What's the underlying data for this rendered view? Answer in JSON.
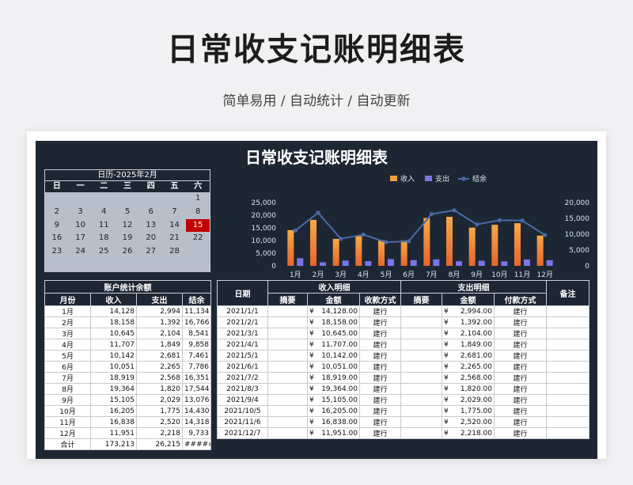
{
  "hero": {
    "title": "日常收支记账明细表",
    "subtitle": "简单易用  /  自动统计  /  自动更新"
  },
  "dashboard": {
    "title": "日常收支记账明细表"
  },
  "calendar": {
    "header": "日历-2025年2月",
    "weekdays": [
      "日",
      "一",
      "二",
      "三",
      "四",
      "五",
      "六"
    ],
    "weeks": [
      [
        "",
        "",
        "",
        "",
        "",
        "",
        "1"
      ],
      [
        "2",
        "3",
        "4",
        "5",
        "6",
        "7",
        "8"
      ],
      [
        "9",
        "10",
        "11",
        "12",
        "13",
        "14",
        "15"
      ],
      [
        "16",
        "17",
        "18",
        "19",
        "20",
        "21",
        "22"
      ],
      [
        "23",
        "24",
        "25",
        "26",
        "27",
        "28",
        ""
      ]
    ],
    "highlight": "15",
    "highlight_color": "#c00000"
  },
  "chart_data": {
    "type": "bar",
    "categories": [
      "1月",
      "2月",
      "3月",
      "4月",
      "5月",
      "6月",
      "7月",
      "8月",
      "9月",
      "10月",
      "11月",
      "12月"
    ],
    "series": [
      {
        "name": "收入",
        "type": "bar",
        "axis": "left",
        "color": "#f5a040",
        "values": [
          14128,
          18158,
          10645,
          11707,
          10142,
          10051,
          18919,
          19364,
          15105,
          16205,
          16838,
          11951
        ]
      },
      {
        "name": "支出",
        "type": "bar",
        "axis": "left",
        "color": "#7b74e8",
        "values": [
          2994,
          1392,
          2104,
          1849,
          2681,
          2265,
          2568,
          1820,
          2029,
          1775,
          2520,
          2218
        ]
      },
      {
        "name": "结余",
        "type": "line",
        "axis": "right",
        "color": "#4a6aa5",
        "values": [
          11134,
          16766,
          8541,
          9858,
          7461,
          7786,
          16351,
          17544,
          13076,
          14430,
          14318,
          9733
        ]
      }
    ],
    "y_left": {
      "min": 0,
      "max": 25000,
      "ticks": [
        "25,000",
        "20,000",
        "15,000",
        "10,000",
        "5,000",
        "0"
      ]
    },
    "y_right": {
      "min": 0,
      "max": 20000,
      "ticks": [
        "20,000",
        "15,000",
        "10,000",
        "5,000",
        "0"
      ]
    },
    "legend_position": "top-right",
    "grid": false
  },
  "account": {
    "title": "账户统计余额",
    "headers": [
      "月份",
      "收入",
      "支出",
      "结余"
    ],
    "rows": [
      [
        "1月",
        "14,128",
        "2,994",
        "11,134"
      ],
      [
        "2月",
        "18,158",
        "1,392",
        "16,766"
      ],
      [
        "3月",
        "10,645",
        "2,104",
        "8,541"
      ],
      [
        "4月",
        "11,707",
        "1,849",
        "9,858"
      ],
      [
        "5月",
        "10,142",
        "2,681",
        "7,461"
      ],
      [
        "6月",
        "10,051",
        "2,265",
        "7,786"
      ],
      [
        "7月",
        "18,919",
        "2,568",
        "16,351"
      ],
      [
        "8月",
        "19,364",
        "1,820",
        "17,544"
      ],
      [
        "9月",
        "15,105",
        "2,029",
        "13,076"
      ],
      [
        "10月",
        "16,205",
        "1,775",
        "14,430"
      ],
      [
        "11月",
        "16,838",
        "2,520",
        "14,318"
      ],
      [
        "12月",
        "11,951",
        "2,218",
        "9,733"
      ],
      [
        "合计",
        "173,213",
        "26,215",
        "######"
      ]
    ]
  },
  "detail": {
    "date_header": "日期",
    "income_header": "收入明细",
    "expense_header": "支出明细",
    "note_header": "备注",
    "sub_headers": [
      "摘要",
      "金额",
      "收款方式",
      "摘要",
      "金额",
      "付款方式"
    ],
    "currency": "¥",
    "rows": [
      {
        "date": "2021/1/1",
        "in_amt": "14,128.00",
        "in_method": "建行",
        "out_amt": "2,994.00",
        "out_method": "建行"
      },
      {
        "date": "2021/2/1",
        "in_amt": "18,158.00",
        "in_method": "建行",
        "out_amt": "1,392.00",
        "out_method": "建行"
      },
      {
        "date": "2021/3/1",
        "in_amt": "10,645.00",
        "in_method": "建行",
        "out_amt": "2,104.00",
        "out_method": "建行"
      },
      {
        "date": "2021/4/1",
        "in_amt": "11,707.00",
        "in_method": "建行",
        "out_amt": "1,849.00",
        "out_method": "建行"
      },
      {
        "date": "2021/5/1",
        "in_amt": "10,142.00",
        "in_method": "建行",
        "out_amt": "2,681.00",
        "out_method": "建行"
      },
      {
        "date": "2021/6/1",
        "in_amt": "10,051.00",
        "in_method": "建行",
        "out_amt": "2,265.00",
        "out_method": "建行"
      },
      {
        "date": "2021/7/2",
        "in_amt": "18,919.00",
        "in_method": "建行",
        "out_amt": "2,568.00",
        "out_method": "建行"
      },
      {
        "date": "2021/8/3",
        "in_amt": "19,364.00",
        "in_method": "建行",
        "out_amt": "1,820.00",
        "out_method": "建行"
      },
      {
        "date": "2021/9/4",
        "in_amt": "15,105.00",
        "in_method": "建行",
        "out_amt": "2,029.00",
        "out_method": "建行"
      },
      {
        "date": "2021/10/5",
        "in_amt": "16,205.00",
        "in_method": "建行",
        "out_amt": "1,775.00",
        "out_method": "建行"
      },
      {
        "date": "2021/11/6",
        "in_amt": "16,838.00",
        "in_method": "建行",
        "out_amt": "2,520.00",
        "out_method": "建行"
      },
      {
        "date": "2021/12/7",
        "in_amt": "11,951.00",
        "in_method": "建行",
        "out_amt": "2,218.00",
        "out_method": "建行"
      }
    ]
  }
}
